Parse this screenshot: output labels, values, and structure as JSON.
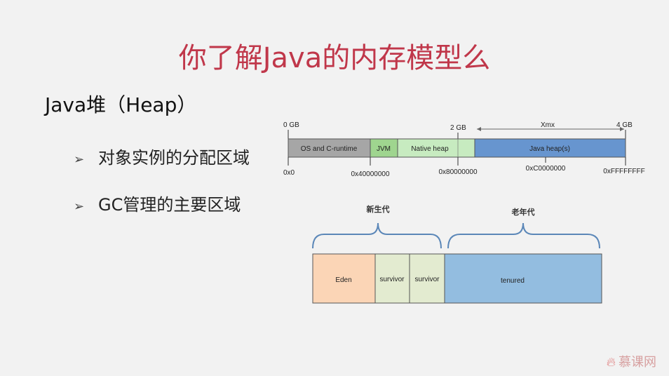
{
  "title": "你了解Java的内存模型么",
  "heading": "Java堆（Heap）",
  "bullets": [
    "对象实例的分配区域",
    "GC管理的主要区域"
  ],
  "bullet_marker": "➢",
  "address_diagram": {
    "top_labels": {
      "gb0": "0 GB",
      "gb2": "2 GB",
      "xmx": "Xmx",
      "gb4": "4 GB"
    },
    "segments": [
      {
        "label": "OS and C-runtime",
        "color": "#a6a6a6"
      },
      {
        "label": "JVM",
        "color": "#9fd58f"
      },
      {
        "label": "Native heap",
        "color": "#c7ebc0"
      },
      {
        "label": "Java heap(s)",
        "color": "#6795cf"
      }
    ],
    "addresses": [
      "0x0",
      "0x40000000",
      "0x80000000",
      "0xC0000000",
      "0xFFFFFFFF"
    ]
  },
  "generation_diagram": {
    "young_label": "新生代",
    "old_label": "老年代",
    "regions": [
      {
        "label": "Eden",
        "color": "#fbd5b6"
      },
      {
        "label": "survivor",
        "color": "#e3ebd0"
      },
      {
        "label": "survivor",
        "color": "#e3ebd0"
      },
      {
        "label": "tenured",
        "color": "#93bde0"
      }
    ]
  },
  "logo_text": "慕课网",
  "logo_icon": "flame-icon"
}
